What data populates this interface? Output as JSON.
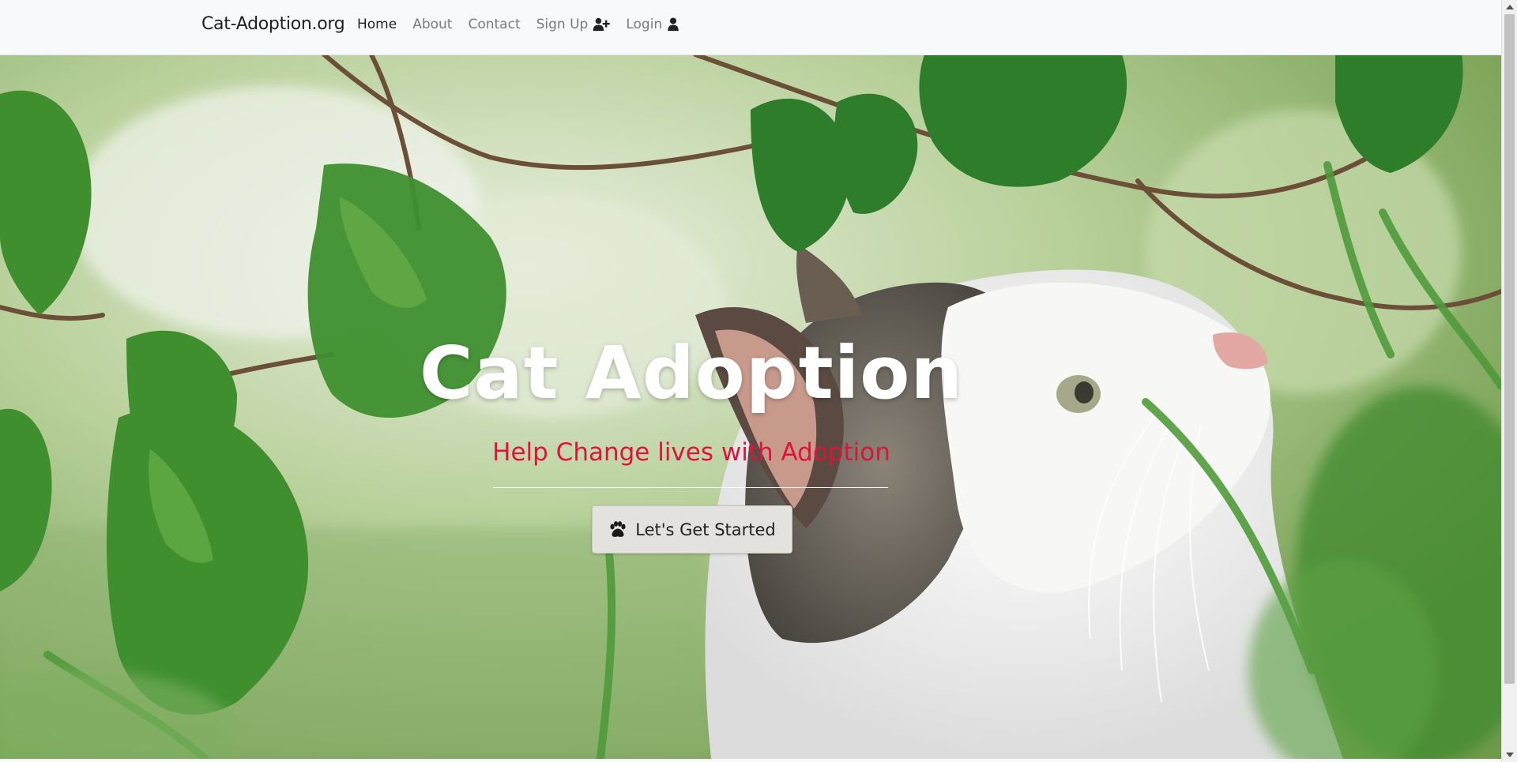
{
  "navbar": {
    "brand": "Cat-Adoption.org",
    "links": [
      {
        "label": "Home",
        "active": true
      },
      {
        "label": "About",
        "active": false
      },
      {
        "label": "Contact",
        "active": false
      },
      {
        "label": "Sign Up",
        "active": false,
        "icon": "user-plus-icon"
      },
      {
        "label": "Login",
        "active": false,
        "icon": "user-icon"
      }
    ]
  },
  "hero": {
    "title": "Cat Adoption",
    "subtitle": "Help Change lives with Adoption",
    "cta_label": "Let's Get Started",
    "cta_icon": "paw-icon",
    "background": "photo of a grey-and-white cat looking up through green leaves",
    "colors": {
      "title": "#ffffff",
      "subtitle": "#dc143c",
      "button_bg": "#e4e2df"
    }
  }
}
